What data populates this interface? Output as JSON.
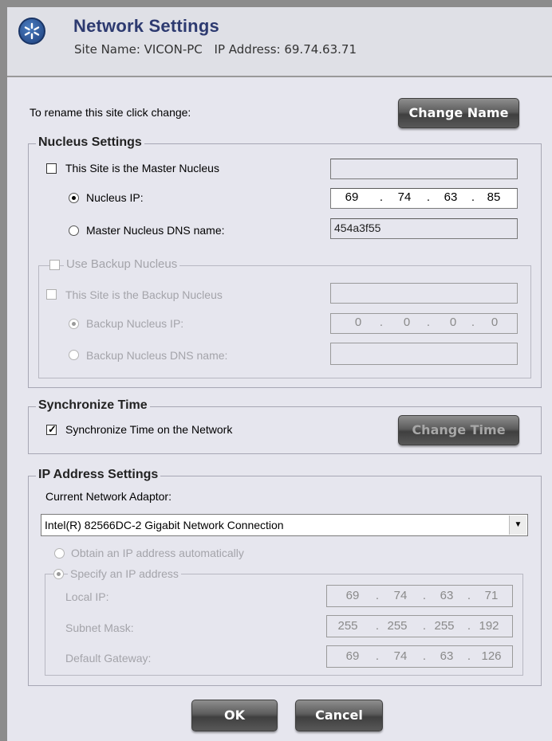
{
  "header": {
    "title": "Network Settings",
    "site_name": "Site Name: VICON-PC",
    "ip_address": "IP Address: 69.74.63.71",
    "logo_icon": "network-star-icon"
  },
  "rename": {
    "text": "To rename this site click change:",
    "button": "Change Name"
  },
  "nucleus": {
    "title": "Nucleus Settings",
    "master_label": "This Site is the Master Nucleus",
    "master_checked": false,
    "nucleus_ip_label": "Nucleus IP:",
    "nucleus_ip": [
      "69",
      "74",
      "63",
      "85"
    ],
    "dns_label": "Master Nucleus DNS name:",
    "dns_value": "454a3f55",
    "backup": {
      "title": "Use Backup Nucleus",
      "site_label": "This Site is the Backup Nucleus",
      "ip_label": "Backup Nucleus IP:",
      "ip": [
        "0",
        "0",
        "0",
        "0"
      ],
      "dns_label": "Backup Nucleus DNS name:"
    }
  },
  "sync": {
    "title": "Synchronize Time",
    "label": "Synchronize Time on the Network",
    "checked": true,
    "button": "Change Time"
  },
  "ip_settings": {
    "title": "IP Address Settings",
    "adaptor_label": "Current Network Adaptor:",
    "adaptor_value": "Intel(R) 82566DC-2 Gigabit Network Connection",
    "auto_label": "Obtain an IP address automatically",
    "specify_label": "Specify an IP address",
    "local_ip_label": "Local IP:",
    "local_ip": [
      "69",
      "74",
      "63",
      "71"
    ],
    "subnet_label": "Subnet Mask:",
    "subnet": [
      "255",
      "255",
      "255",
      "192"
    ],
    "gateway_label": "Default Gateway:",
    "gateway": [
      "69",
      "74",
      "63",
      "126"
    ]
  },
  "footer": {
    "ok": "OK",
    "cancel": "Cancel"
  }
}
